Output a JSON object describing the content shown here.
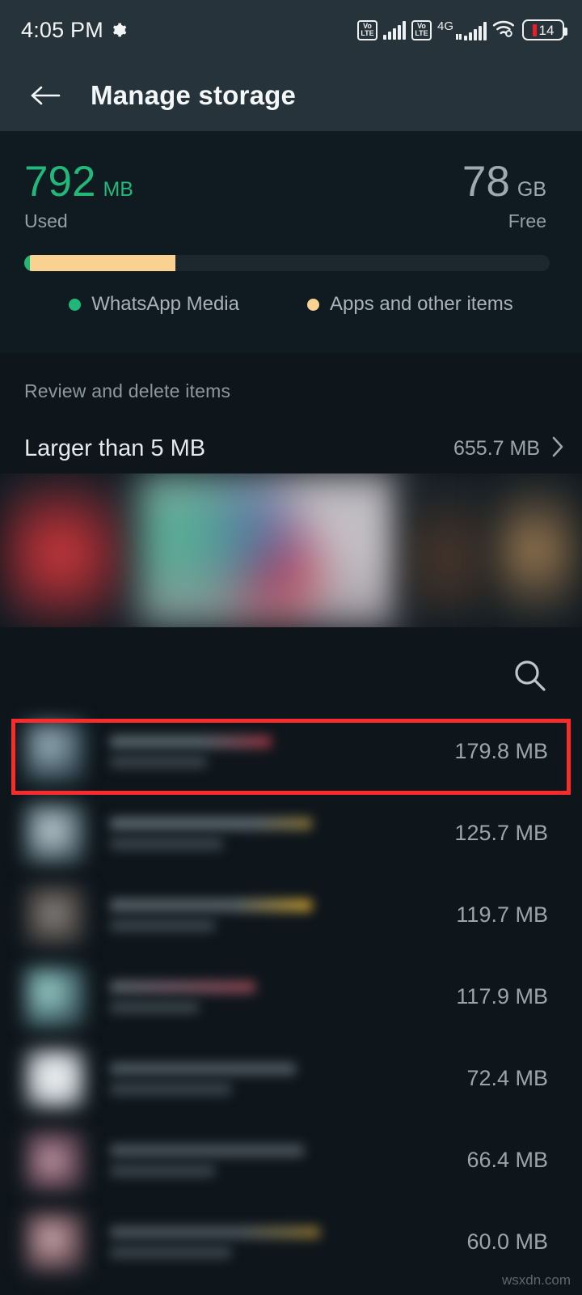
{
  "statusbar": {
    "time": "4:05 PM",
    "gear_icon": "gear-icon",
    "volte_top": "Vo",
    "volte_bottom": "LTE",
    "network_type": "4G",
    "wifi_icon": "wifi-icon",
    "battery_level": "14"
  },
  "appbar": {
    "back_icon": "back-arrow-icon",
    "title": "Manage storage"
  },
  "summary": {
    "used": {
      "value": "792",
      "unit": "MB",
      "label": "Used",
      "color": "#20B97A"
    },
    "free": {
      "value": "78",
      "unit": "GB",
      "label": "Free",
      "color": "#9FAAB0"
    },
    "legend": [
      {
        "label": "WhatsApp Media",
        "color": "#1FB877"
      },
      {
        "label": "Apps and other items",
        "color": "#F9D292"
      }
    ]
  },
  "review": {
    "section_title": "Review and delete items",
    "larger_than": {
      "label": "Larger than 5 MB",
      "size": "655.7 MB",
      "chevron_icon": "chevron-right-icon"
    }
  },
  "search": {
    "icon": "search-icon"
  },
  "files": [
    {
      "size": "179.8 MB",
      "highlighted": true
    },
    {
      "size": "125.7 MB",
      "highlighted": false
    },
    {
      "size": "119.7 MB",
      "highlighted": false
    },
    {
      "size": "117.9 MB",
      "highlighted": false
    },
    {
      "size": "72.4 MB",
      "highlighted": false
    },
    {
      "size": "66.4 MB",
      "highlighted": false
    },
    {
      "size": "60.0 MB",
      "highlighted": false
    }
  ],
  "watermark": "wsxdn.com"
}
